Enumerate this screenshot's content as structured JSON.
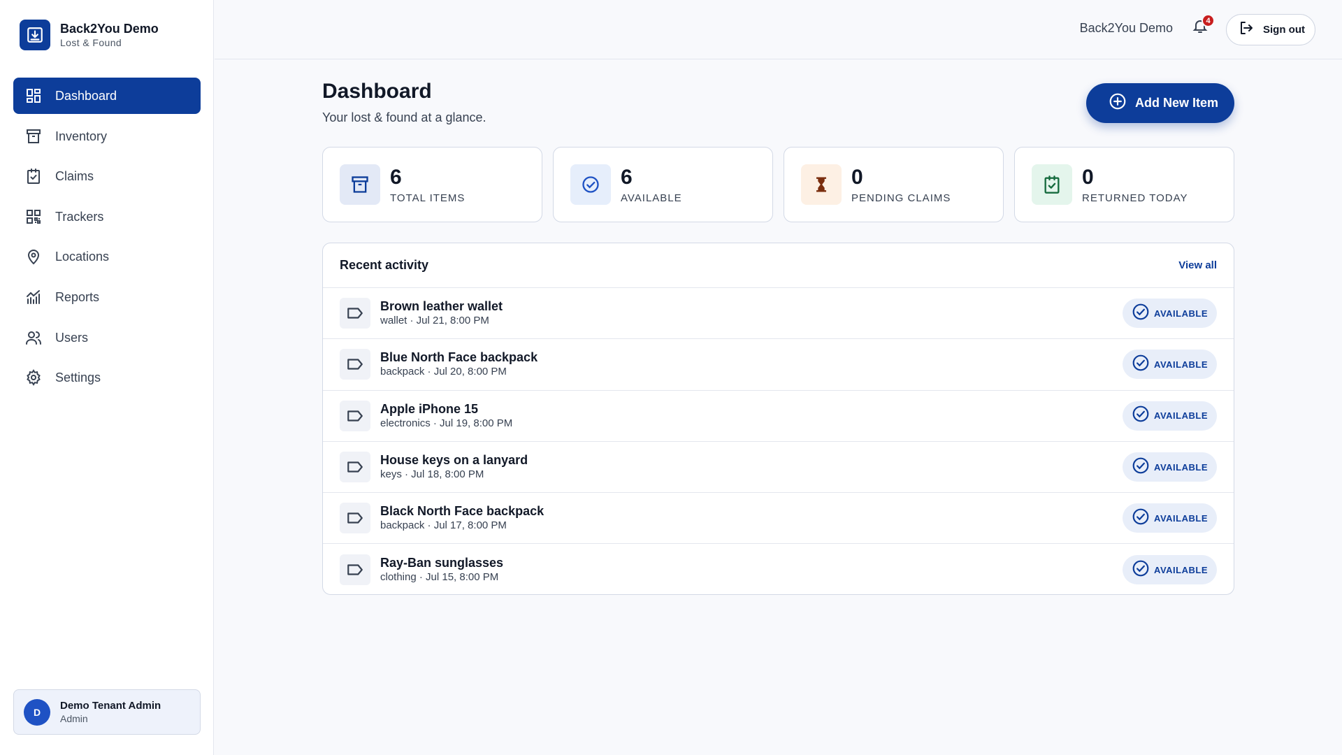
{
  "brand": {
    "title": "Back2You Demo",
    "subtitle": "Lost & Found"
  },
  "sidebar": {
    "items": [
      {
        "label": "Dashboard",
        "icon": "dashboard-icon",
        "active": true
      },
      {
        "label": "Inventory",
        "icon": "archive-box-icon"
      },
      {
        "label": "Claims",
        "icon": "clipboard-check-icon"
      },
      {
        "label": "Trackers",
        "icon": "qr-code-icon"
      },
      {
        "label": "Locations",
        "icon": "map-pin-icon"
      },
      {
        "label": "Reports",
        "icon": "chart-line-icon"
      },
      {
        "label": "Users",
        "icon": "users-icon"
      },
      {
        "label": "Settings",
        "icon": "gear-icon"
      }
    ]
  },
  "user": {
    "initial": "D",
    "name": "Demo Tenant Admin",
    "role": "Admin"
  },
  "topbar": {
    "tenant": "Back2You Demo",
    "notifications": "4",
    "signout_label": "Sign out"
  },
  "page": {
    "title": "Dashboard",
    "subtitle": "Your lost & found at a glance.",
    "add_label": "Add New Item"
  },
  "stats": [
    {
      "value": "6",
      "label": "TOTAL ITEMS",
      "icon": "archive-box-icon",
      "color": "#e3e9f6"
    },
    {
      "value": "6",
      "label": "AVAILABLE",
      "icon": "check-circle-icon",
      "color": "#e6eefb"
    },
    {
      "value": "0",
      "label": "PENDING CLAIMS",
      "icon": "hourglass-icon",
      "color": "#fdf0e4"
    },
    {
      "value": "0",
      "label": "RETURNED TODAY",
      "icon": "clipboard-check-icon",
      "color": "#e4f5ec"
    }
  ],
  "activity": {
    "title": "Recent activity",
    "view_all": "View all",
    "items": [
      {
        "title": "Brown leather wallet",
        "meta": "wallet · Jul 21, 8:00 PM",
        "status": "AVAILABLE"
      },
      {
        "title": "Blue North Face backpack",
        "meta": "backpack · Jul 20, 8:00 PM",
        "status": "AVAILABLE"
      },
      {
        "title": "Apple iPhone 15",
        "meta": "electronics · Jul 19, 8:00 PM",
        "status": "AVAILABLE"
      },
      {
        "title": "House keys on a lanyard",
        "meta": "keys · Jul 18, 8:00 PM",
        "status": "AVAILABLE"
      },
      {
        "title": "Black North Face backpack",
        "meta": "backpack · Jul 17, 8:00 PM",
        "status": "AVAILABLE"
      },
      {
        "title": "Ray-Ban sunglasses",
        "meta": "clothing · Jul 15, 8:00 PM",
        "status": "AVAILABLE"
      }
    ]
  },
  "colors": {
    "primary": "#0d3d9a",
    "badge_bg": "#e8eef9",
    "danger": "#c81e1e"
  }
}
